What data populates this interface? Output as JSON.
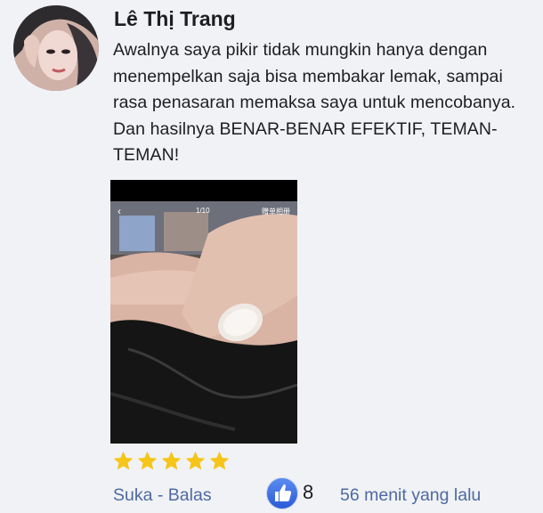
{
  "comment": {
    "author": "Lê Thị Trang",
    "text": "Awalnya saya pikir tidak mungkin hanya dengan menempelkan saja bisa membakar lemak, sampai rasa penasaran memaksa saya untuk mencobanya. Dan hasilnya BENAR-BENAR EFEKTIF, TEMAN-TEMAN!",
    "photo": {
      "counter": "1/10",
      "tag": "赠单相册",
      "back_glyph": "‹"
    },
    "rating": 5,
    "actions": {
      "like_label": "Suka",
      "separator": " - ",
      "reply_label": "Balas"
    },
    "like_count": "8",
    "timestamp": "56 menit yang lalu"
  },
  "colors": {
    "background": "#f0f2f5",
    "link": "#4e69a2",
    "star": "#f5c518",
    "like_badge": "#2f63de"
  },
  "icons": {
    "avatar": "user-avatar",
    "star": "star-icon",
    "like": "thumbs-up-icon"
  }
}
